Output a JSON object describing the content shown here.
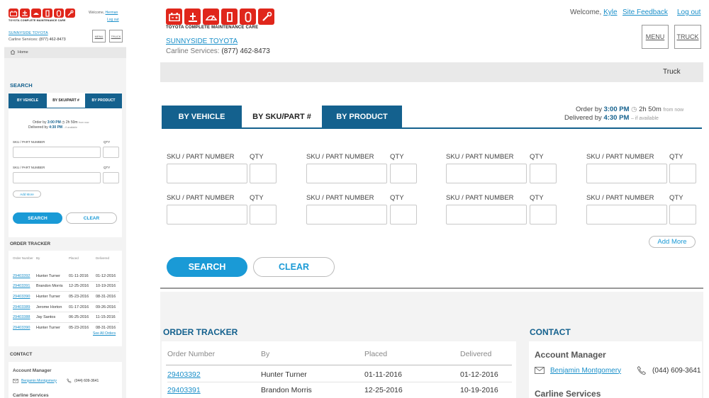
{
  "brand": {
    "tagline": "TOYOTA COMPLETE MAINTENANCE CARE",
    "dealer": "SUNNYSIDE TOYOTA",
    "carline_label": "Carline Services:",
    "carline_phone": "(877) 462-8473",
    "accent_red": "#e0261b",
    "accent_blue": "#1a9ad6",
    "dark_blue": "#14618e"
  },
  "desktop": {
    "welcome": "Welcome,",
    "user": "Kyle",
    "site_feedback": "Site Feedback",
    "logout": "Log out",
    "menu": "MENU",
    "truck_btn": "TRUCK",
    "breadcrumb": "Truck",
    "tabs": [
      {
        "label": "BY VEHICLE",
        "active": false
      },
      {
        "label": "BY SKU/PART #",
        "active": true
      },
      {
        "label": "BY PRODUCT",
        "active": false
      }
    ],
    "order_by_label": "Order by",
    "order_by_time": "3:00 PM",
    "countdown": "2h 50m",
    "from_now": "from now",
    "delivered_by_label": "Delivered by",
    "delivered_by_time": "4:30 PM",
    "if_available": "– if available",
    "sku_label": "SKU / PART NUMBER",
    "qty_label": "QTY",
    "add_more": "Add More",
    "search": "SEARCH",
    "clear": "CLEAR",
    "order_tracker": {
      "title": "ORDER TRACKER",
      "headers": [
        "Order Number",
        "By",
        "Placed",
        "Delivered"
      ],
      "rows": [
        [
          "29403392",
          "Hunter Turner",
          "01-11-2016",
          "01-12-2016"
        ],
        [
          "29403391",
          "Brandon Morris",
          "12-25-2016",
          "10-19-2016"
        ]
      ]
    },
    "contact": {
      "title": "CONTACT",
      "account_manager": "Account Manager",
      "manager_name": "Benjamin Montgomery",
      "manager_phone": "(044) 609-3641",
      "carline_services": "Carline Services"
    }
  },
  "mobile": {
    "welcome": "Welcome,",
    "user": "Herman",
    "logout": "Log out",
    "menu": "MENU",
    "truck_btn": "TRUCK",
    "home": "Home",
    "search_title": "SEARCH",
    "tabs": [
      "BY VEHICLE",
      "BY SKU/PART #",
      "BY PRODUCT"
    ],
    "order_by_label": "Order by",
    "order_by_time": "3:00 PM",
    "countdown": "2h 50m",
    "from_now": "from now",
    "delivered_by_label": "Delivered by",
    "delivered_by_time": "4:30 PM",
    "if_available": "– if available",
    "sku_label": "SKU / PART NUMBER",
    "qty_label": "QTY",
    "add_more": "Add More",
    "search": "SEARCH",
    "clear": "CLEAR",
    "order_tracker": {
      "title": "ORDER TRACKER",
      "headers": [
        "Order Number",
        "By",
        "Placed",
        "Delivered"
      ],
      "rows": [
        [
          "29403392",
          "Hunter Turner",
          "01-11-2016",
          "01-12-2016"
        ],
        [
          "29403391",
          "Brandon Morris",
          "12-25-2016",
          "10-19-2016"
        ],
        [
          "29403390",
          "Hunter Turner",
          "05-23-2016",
          "08-31-2016"
        ],
        [
          "29403389",
          "Jerome Horton",
          "01-17-2016",
          "09-26-2016"
        ],
        [
          "29403388",
          "Jay Santos",
          "06-25-2016",
          "11-15-2016"
        ],
        [
          "29403390",
          "Hunter Turner",
          "05-23-2016",
          "08-31-2016"
        ]
      ],
      "see_all": "See All Orders"
    },
    "contact": {
      "title": "CONTACT",
      "account_manager": "Account Manager",
      "manager_name": "Benjamin Montgomery",
      "manager_phone": "(044) 609-3641",
      "carline_services": "Carline Services"
    }
  }
}
